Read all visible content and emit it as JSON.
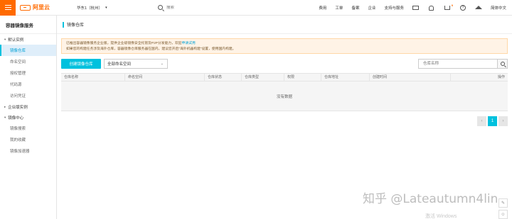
{
  "topbar": {
    "logo_text": "阿里云",
    "region": "华东1（杭州）",
    "search_placeholder": "搜索",
    "nav": [
      "费用",
      "工单",
      "备案",
      "企业",
      "支持与服务"
    ],
    "cart_count": "9",
    "help_glyph": "?",
    "language": "简体中文"
  },
  "sidebar": {
    "title": "容器镜像服务",
    "groups": [
      {
        "label": "默认实例",
        "items": [
          "镜像仓库",
          "命名空间",
          "授权管理",
          "代码源",
          "访问凭证"
        ]
      },
      {
        "label": "企业版实例",
        "items": []
      },
      {
        "label": "镜像中心",
        "items": [
          "镜像搜索",
          "我的收藏",
          "镜像加速器"
        ]
      }
    ]
  },
  "main": {
    "title": "镜像仓库",
    "notice_line1": "已推出容器镜像服务企业版，提供企业级镜像安全托管及P2P分发能力，欢迎",
    "notice_link": "申请试用",
    "notice_line2": "如果您的构建任务涉及海外仓库，容器镜像仓库服务器在国内，建议您开启\"海外机器构建\"设置，使用国内构建。",
    "create_button": "创建镜像仓库",
    "namespace_select": "全部命名空间",
    "repo_search_placeholder": "仓库名称",
    "columns": [
      "仓库名称",
      "命名空间",
      "仓库状态",
      "仓库类型",
      "权限",
      "仓库地址",
      "创建时间",
      "操作"
    ],
    "empty_text": "没有数据",
    "pager": {
      "prev": "‹",
      "current": "1",
      "next": "›"
    }
  },
  "overlay": {
    "watermark": "知乎 @Lateautumn4lin",
    "windows_text": "激活 Windows"
  }
}
